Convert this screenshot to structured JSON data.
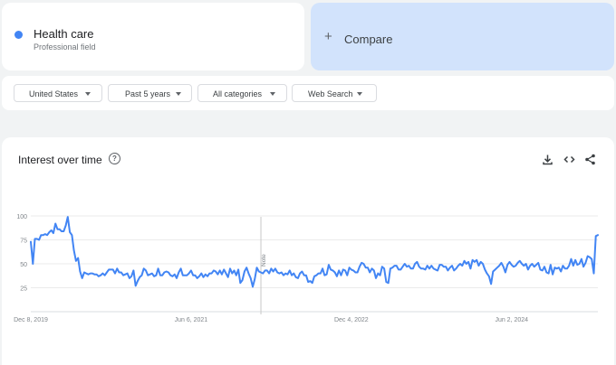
{
  "term": {
    "name": "Health care",
    "subtitle": "Professional field",
    "color": "#4285f4"
  },
  "compare": {
    "icon": "plus-icon",
    "label": "Compare"
  },
  "filters": [
    {
      "label": "United States"
    },
    {
      "label": "Past 5 years"
    },
    {
      "label": "All categories"
    },
    {
      "label": "Web Search"
    }
  ],
  "chart": {
    "title": "Interest over time",
    "icons": [
      "help-icon",
      "download-icon",
      "embed-icon",
      "share-icon"
    ]
  },
  "chart_data": {
    "type": "line",
    "title": "Interest over time",
    "xlabel": "",
    "ylabel": "",
    "ylim": [
      0,
      100
    ],
    "yticks": [
      25,
      50,
      75,
      100
    ],
    "grid": true,
    "x_ticks": [
      "Dec 8, 2019",
      "Jun 6, 2021",
      "Dec 4, 2022",
      "Jun 2, 2024"
    ],
    "x_tick_weeks": [
      0,
      78,
      156,
      234
    ],
    "annotation": {
      "label": "Note",
      "week": 112
    },
    "series": [
      {
        "color": "#4285f4",
        "values": [
          73,
          50,
          76,
          76,
          75,
          80,
          80,
          81,
          80,
          83,
          85,
          82,
          92,
          86,
          86,
          84,
          84,
          90,
          99,
          83,
          80,
          64,
          53,
          56,
          42,
          35,
          41,
          40,
          39,
          40,
          40,
          39,
          39,
          37,
          38,
          40,
          38,
          41,
          44,
          44,
          44,
          40,
          45,
          41,
          41,
          38,
          39,
          40,
          35,
          37,
          43,
          27,
          32,
          36,
          38,
          45,
          43,
          38,
          39,
          40,
          37,
          38,
          45,
          38,
          38,
          41,
          42,
          41,
          38,
          37,
          39,
          35,
          41,
          45,
          38,
          38,
          38,
          40,
          43,
          38,
          38,
          35,
          37,
          40,
          36,
          39,
          37,
          40,
          40,
          43,
          42,
          39,
          43,
          39,
          44,
          40,
          36,
          45,
          40,
          43,
          38,
          44,
          30,
          33,
          42,
          46,
          40,
          35,
          26,
          34,
          46,
          42,
          41,
          40,
          43,
          43,
          40,
          45,
          42,
          45,
          41,
          40,
          41,
          38,
          40,
          39,
          43,
          38,
          40,
          36,
          35,
          40,
          42,
          38,
          38,
          31,
          32,
          30,
          37,
          38,
          40,
          40,
          45,
          38,
          39,
          49,
          44,
          43,
          41,
          37,
          43,
          38,
          44,
          43,
          38,
          46,
          44,
          43,
          41,
          41,
          47,
          51,
          50,
          46,
          46,
          41,
          45,
          43,
          35,
          40,
          38,
          47,
          45,
          31,
          30,
          45,
          46,
          48,
          48,
          44,
          44,
          47,
          50,
          47,
          48,
          45,
          45,
          50,
          52,
          47,
          45,
          45,
          44,
          48,
          45,
          48,
          45,
          44,
          43,
          49,
          49,
          47,
          47,
          43,
          46,
          48,
          43,
          45,
          48,
          50,
          48,
          53,
          50,
          52,
          45,
          54,
          52,
          54,
          48,
          52,
          50,
          44,
          40,
          37,
          29,
          42,
          44,
          46,
          48,
          51,
          47,
          41,
          49,
          52,
          49,
          47,
          48,
          51,
          53,
          50,
          48,
          50,
          44,
          48,
          50,
          47,
          49,
          51,
          44,
          43,
          47,
          41,
          40,
          49,
          39,
          46,
          45,
          46,
          42,
          48,
          45,
          45,
          48,
          55,
          48,
          54,
          49,
          50,
          55,
          47,
          51,
          58,
          57,
          55,
          40,
          79,
          80
        ]
      }
    ]
  }
}
